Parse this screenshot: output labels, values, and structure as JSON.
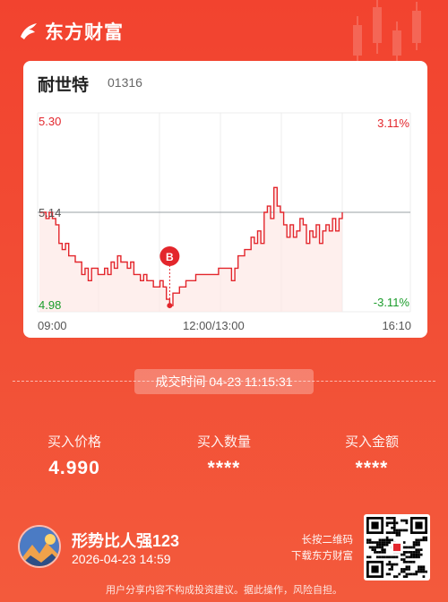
{
  "brand": {
    "name": "东方财富",
    "logo_icon": "eastmoney-logo-icon"
  },
  "stock": {
    "name": "耐世特",
    "code": "01316"
  },
  "chart_data": {
    "type": "line",
    "price_labels": {
      "high": "5.30",
      "mid": "5.14",
      "low": "4.98"
    },
    "pct_labels": {
      "high": "3.11%",
      "low": "-3.11%"
    },
    "time_labels": [
      "09:00",
      "12:00/13:00",
      "16:10"
    ],
    "ylim": [
      4.98,
      5.3
    ],
    "reference_price": 5.14,
    "trade_marker": {
      "label": "B",
      "price": 4.99
    },
    "series": [
      {
        "values": [
          5.14,
          5.14,
          5.13,
          5.14,
          5.13,
          5.12,
          5.09,
          5.08,
          5.09,
          5.07,
          5.07,
          5.06,
          5.06,
          5.04,
          5.05,
          5.03,
          5.05,
          5.05,
          5.04,
          5.04,
          5.05,
          5.04,
          5.06,
          5.05,
          5.07,
          5.06,
          5.06,
          5.05,
          5.06,
          5.04,
          5.04,
          5.03,
          5.04,
          5.03,
          5.03,
          5.02,
          5.02,
          5.03,
          5.02,
          5.0,
          4.99,
          5.01,
          5.01,
          5.02,
          5.02,
          5.03,
          5.03,
          5.03,
          5.04,
          5.04,
          5.04,
          5.04,
          5.04,
          5.04,
          5.04,
          5.05,
          5.05,
          5.05,
          5.05,
          5.03,
          5.05,
          5.07,
          5.07,
          5.08,
          5.08,
          5.1,
          5.09,
          5.11,
          5.09,
          5.14,
          5.15,
          5.13,
          5.18,
          5.15,
          5.14,
          5.12,
          5.1,
          5.12,
          5.1,
          5.11,
          5.13,
          5.12,
          5.09,
          5.11,
          5.1,
          5.12,
          5.09,
          5.11,
          5.12,
          5.11,
          5.13,
          5.11,
          5.13,
          5.14
        ]
      }
    ],
    "colors": {
      "line": "#e3262c",
      "fill": "#fde8e6",
      "grid": "#ececec",
      "ref": "#9aa0a6"
    }
  },
  "trade_time": "成交时间 04-23 11:15:31",
  "stats": [
    {
      "label": "买入价格",
      "value": "4.990"
    },
    {
      "label": "买入数量",
      "value": "****"
    },
    {
      "label": "买入金额",
      "value": "****"
    }
  ],
  "user": {
    "name": "形势比人强123",
    "date": "2026-04-23 14:59",
    "avatar_icon": "mountain-avatar-icon"
  },
  "qr": {
    "line1": "长按二维码",
    "line2": "下载东方财富",
    "icon": "qr-code-icon"
  },
  "disclaimer": "用户分享内容不构成投资建议。据此操作，风险自担。"
}
